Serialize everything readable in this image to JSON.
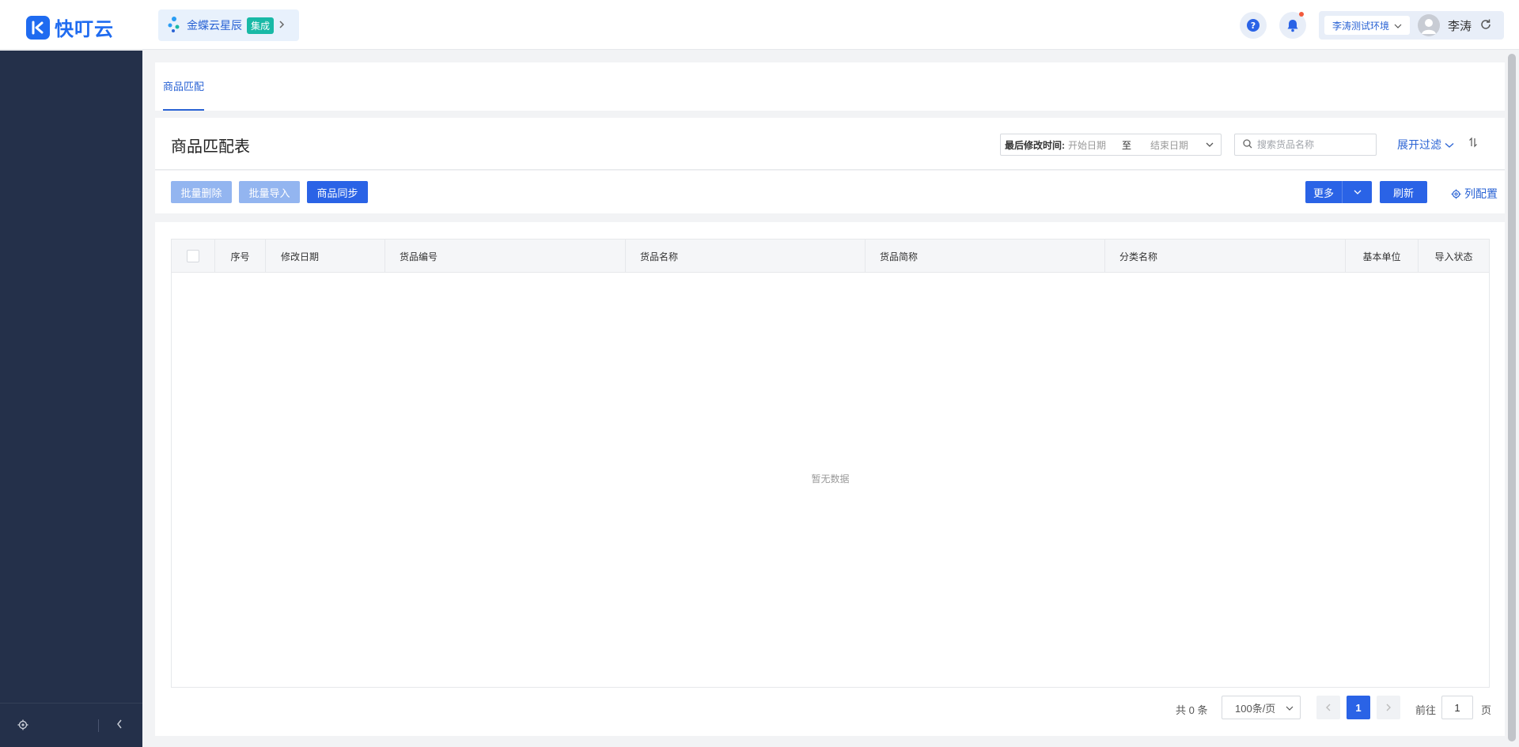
{
  "topbar": {
    "logo_text": "快叮云",
    "app_chip": {
      "name": "金蝶云星辰",
      "badge": "集成"
    },
    "env_select": "李涛测试环境",
    "user_name": "李涛"
  },
  "tabs": [
    {
      "label": "商品匹配"
    }
  ],
  "header": {
    "title": "商品匹配表",
    "date_range": {
      "label": "最后修改时间:",
      "start_placeholder": "开始日期",
      "to": "至",
      "end_placeholder": "结束日期"
    },
    "search_placeholder": "搜索货品名称",
    "expand_filter": "展开过滤"
  },
  "toolbar": {
    "batch_delete": "批量删除",
    "batch_import": "批量导入",
    "sync": "商品同步",
    "more": "更多",
    "refresh": "刷新",
    "column_config": "列配置"
  },
  "table": {
    "columns": [
      "序号",
      "修改日期",
      "货品编号",
      "货品名称",
      "货品简称",
      "分类名称",
      "基本单位",
      "导入状态"
    ],
    "rows": [],
    "empty_text": "暂无数据"
  },
  "pagination": {
    "total_text": "共 0 条",
    "page_size": "100条/页",
    "current_page": "1",
    "goto_label": "前往",
    "goto_value": "1",
    "page_word": "页"
  },
  "colors": {
    "primary": "#2a63e6",
    "primary_disabled": "#93b5f0",
    "sidebar": "#24304a",
    "badge": "#19b9a6"
  }
}
